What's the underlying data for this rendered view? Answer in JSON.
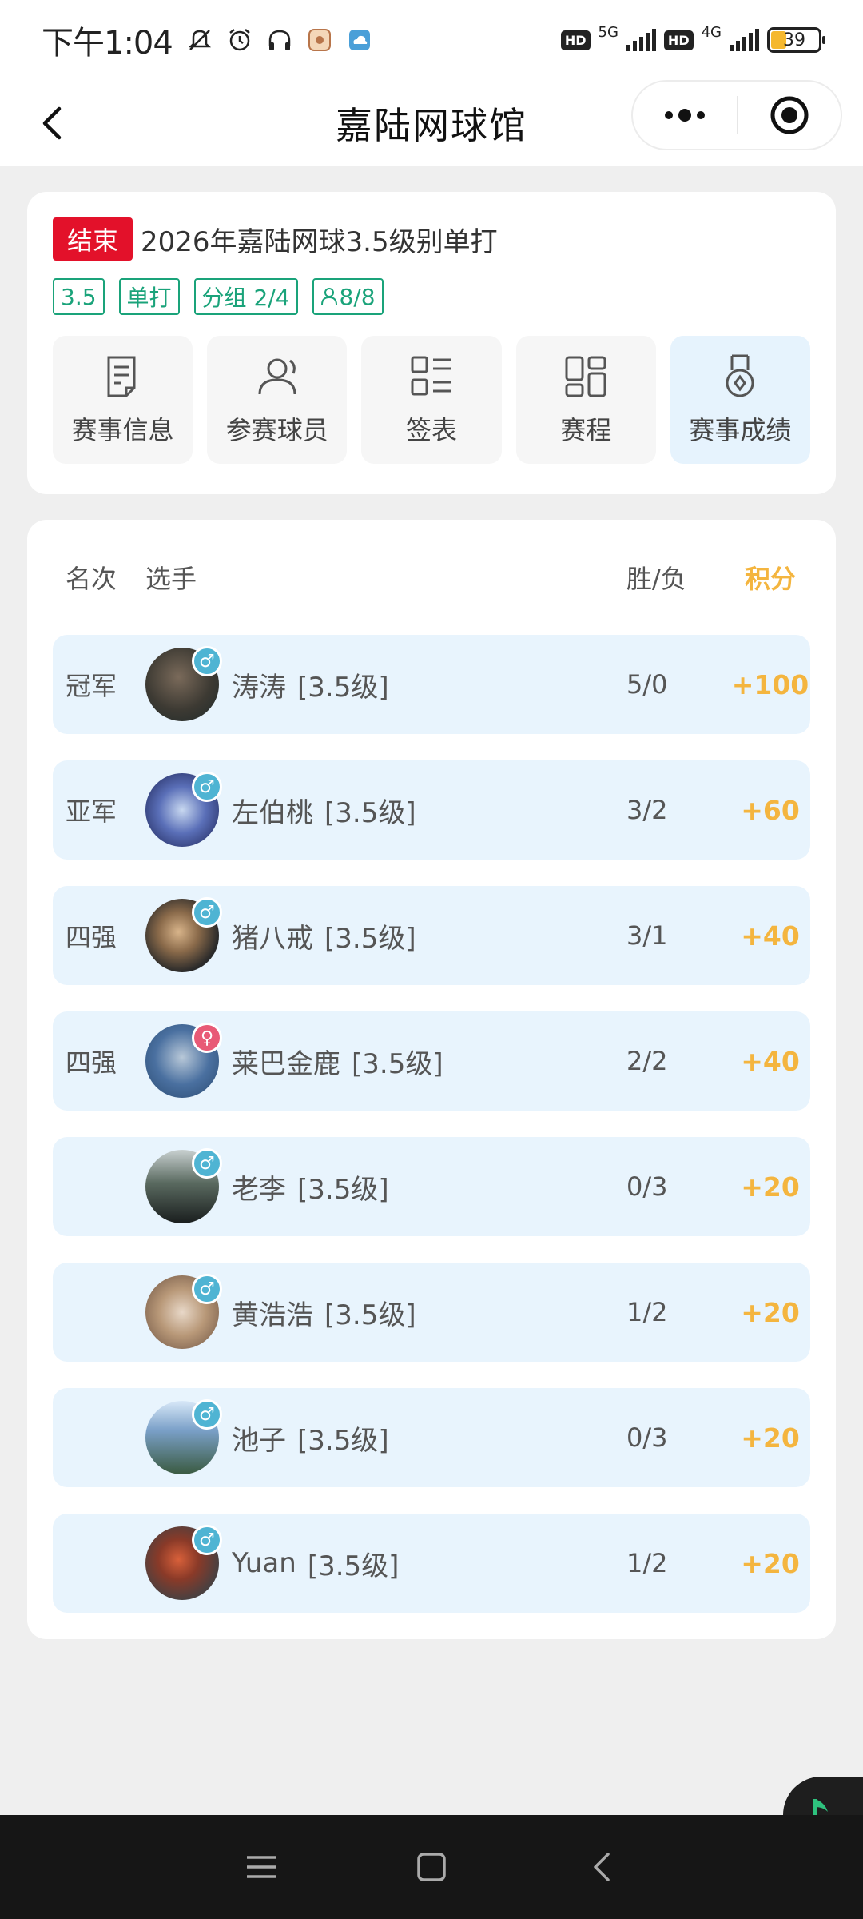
{
  "status_bar": {
    "time": "下午1:04",
    "network_a": "5G",
    "network_b": "4G",
    "hd_label": "HD",
    "battery": "39",
    "icons": [
      "mute-icon",
      "alarm-icon",
      "headphones-icon",
      "app-icon",
      "cloud-icon"
    ]
  },
  "nav": {
    "title": "嘉陆网球馆",
    "back_icon": "chevron-left-icon",
    "more_icon": "more-dots-icon",
    "close_icon": "record-target-icon"
  },
  "event": {
    "status": "结束",
    "title": "2026年嘉陆网球3.5级别单打",
    "tags": {
      "level": "3.5",
      "type": "单打",
      "group": "分组 2/4",
      "players": "8/8"
    },
    "menu": [
      {
        "label": "赛事信息",
        "icon": "document-icon"
      },
      {
        "label": "参赛球员",
        "icon": "user-icon"
      },
      {
        "label": "签表",
        "icon": "list-grid-icon"
      },
      {
        "label": "赛程",
        "icon": "schedule-grid-icon"
      },
      {
        "label": "赛事成绩",
        "icon": "medal-icon"
      }
    ]
  },
  "results": {
    "headers": {
      "rank": "名次",
      "player": "选手",
      "win_loss": "胜/负",
      "points": "积分"
    },
    "rows": [
      {
        "rank": "冠军",
        "name": "涛涛",
        "level": "[3.5级]",
        "wl": "5/0",
        "points": "+100",
        "gender": "♂"
      },
      {
        "rank": "亚军",
        "name": "左伯桃",
        "level": "[3.5级]",
        "wl": "3/2",
        "points": "+60",
        "gender": "♂"
      },
      {
        "rank": "四强",
        "name": "猪八戒",
        "level": "[3.5级]",
        "wl": "3/1",
        "points": "+40",
        "gender": "♂"
      },
      {
        "rank": "四强",
        "name": "莱巴金鹿",
        "level": "[3.5级]",
        "wl": "2/2",
        "points": "+40",
        "gender": "♀"
      },
      {
        "rank": "",
        "name": "老李",
        "level": "[3.5级]",
        "wl": "0/3",
        "points": "+20",
        "gender": "♂"
      },
      {
        "rank": "",
        "name": "黄浩浩",
        "level": "[3.5级]",
        "wl": "1/2",
        "points": "+20",
        "gender": "♂"
      },
      {
        "rank": "",
        "name": "池子",
        "level": "[3.5级]",
        "wl": "0/3",
        "points": "+20",
        "gender": "♂"
      },
      {
        "rank": "",
        "name": "Yuan",
        "level": "[3.5级]",
        "wl": "1/2",
        "points": "+20",
        "gender": "♂"
      }
    ]
  },
  "colors": {
    "accent_green": "#1aa37a",
    "end_red": "#e3112a",
    "points_gold": "#f4b53f",
    "row_blue": "#e8f4fd"
  }
}
